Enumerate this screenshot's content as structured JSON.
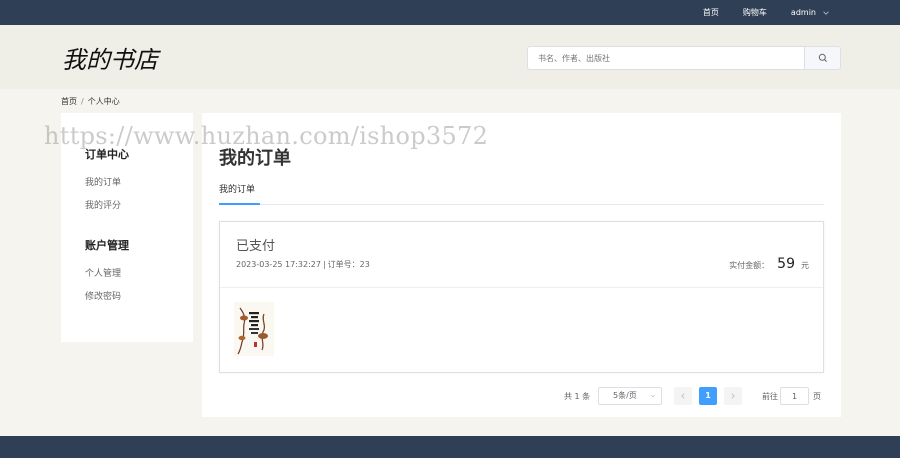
{
  "topbar": {
    "nav": [
      "首页",
      "购物车"
    ],
    "user": "admin"
  },
  "header": {
    "logo": "我的书店",
    "search_placeholder": "书名、作者、出版社"
  },
  "breadcrumb": {
    "items": [
      "首页",
      "个人中心"
    ],
    "separator": "/"
  },
  "sidebar": {
    "groups": [
      {
        "title": "订单中心",
        "links": [
          "我的订单",
          "我的评分"
        ]
      },
      {
        "title": "账户管理",
        "links": [
          "个人管理",
          "修改密码"
        ]
      }
    ]
  },
  "main": {
    "title": "我的订单",
    "tab": "我的订单"
  },
  "order": {
    "status": "已支付",
    "time": "2023-03-25 17:32:27",
    "separator": "|",
    "order_no_label": "订单号：",
    "order_no": "23",
    "paid_label": "实付金额：",
    "paid_amount": "59",
    "paid_unit": "元",
    "book_cover": "book-cover"
  },
  "pagination": {
    "total": "共 1 条",
    "page_size": "5条/页",
    "current_page": "1",
    "goto_label": "前往",
    "goto_value": "1",
    "goto_unit": "页"
  },
  "watermark": "https://www.huzhan.com/ishop3572",
  "colors": {
    "nav_bg": "#2f4056",
    "accent": "#409eff",
    "page_bg": "#f5f4ee"
  }
}
